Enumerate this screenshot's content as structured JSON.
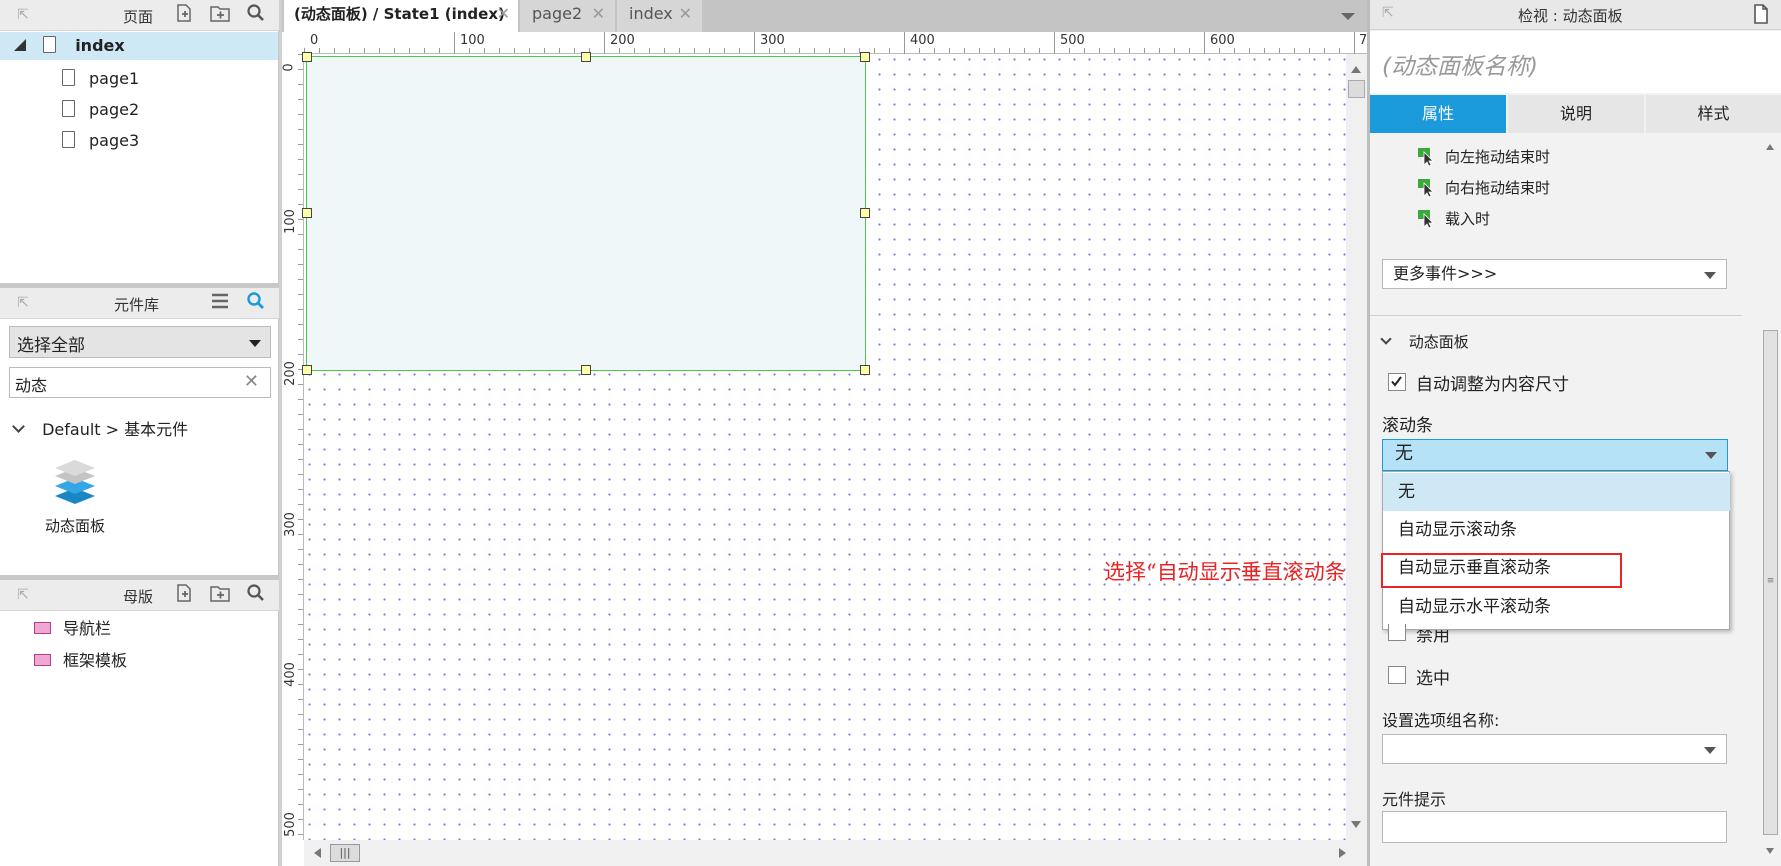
{
  "pages_panel": {
    "title": "页面",
    "items": [
      {
        "label": "index"
      },
      {
        "label": "page1"
      },
      {
        "label": "page2"
      },
      {
        "label": "page3"
      }
    ]
  },
  "library_panel": {
    "title": "元件库",
    "select_value": "选择全部",
    "search_value": "动态",
    "group_label": "Default > 基本元件",
    "widget_label": "动态面板"
  },
  "masters_panel": {
    "title": "母版",
    "items": [
      {
        "label": "导航栏"
      },
      {
        "label": "框架模板"
      }
    ]
  },
  "tabs": [
    {
      "label": "(动态面板) / State1 (index)"
    },
    {
      "label": "page2"
    },
    {
      "label": "index"
    }
  ],
  "ruler": {
    "h_labels": [
      "0",
      "100",
      "200",
      "300",
      "400",
      "500",
      "600",
      "7"
    ],
    "v_labels": [
      "0",
      "100",
      "200",
      "300",
      "400",
      "500"
    ]
  },
  "annotation": {
    "text": "选择“自动显示垂直滚动条”"
  },
  "inspector": {
    "title": "检视 : 动态面板",
    "name_placeholder": "(动态面板名称)",
    "tabs": [
      {
        "label": "属性"
      },
      {
        "label": "说明"
      },
      {
        "label": "样式"
      }
    ],
    "events": [
      {
        "label": "向左拖动结束时"
      },
      {
        "label": "向右拖动结束时"
      },
      {
        "label": "载入时"
      }
    ],
    "more_events": "更多事件>>>",
    "section_title": "动态面板",
    "auto_fit_label": "自动调整为内容尺寸",
    "scrollbar_label": "滚动条",
    "scrollbar_value": "无",
    "scrollbar_options": [
      {
        "label": "无"
      },
      {
        "label": "自动显示滚动条"
      },
      {
        "label": "自动显示垂直滚动条"
      },
      {
        "label": "自动显示水平滚动条"
      }
    ],
    "disabled_label": "禁用",
    "selected_label": "选中",
    "group_name_label": "设置选项组名称:",
    "tooltip_label": "元件提示"
  },
  "colors": {
    "accent": "#1c9bdc",
    "selection": "#cfe8f6",
    "panel_border": "#4cc94c",
    "annotation": "#e82424"
  }
}
